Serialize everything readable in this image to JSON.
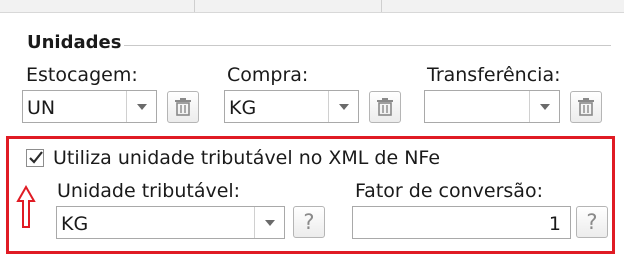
{
  "section": {
    "title": "Unidades"
  },
  "stock": {
    "label": "Estocagem:",
    "value": "UN"
  },
  "purchase": {
    "label": "Compra:",
    "value": "KG"
  },
  "transfer": {
    "label": "Transferência:",
    "value": ""
  },
  "tax": {
    "checkbox_label": "Utiliza unidade tributável no XML de NFe",
    "checked": true,
    "unit_label": "Unidade tributável:",
    "unit_value": "KG",
    "factor_label": "Fator de conversão:",
    "factor_value": "1"
  },
  "help_glyph": "?",
  "icons": {
    "delete": "trash-icon",
    "dropdown": "chevron-down-icon",
    "annotation": "up-arrow-icon"
  },
  "colors": {
    "highlight": "#e01b24",
    "icon_gray": "#8a8a8a"
  }
}
